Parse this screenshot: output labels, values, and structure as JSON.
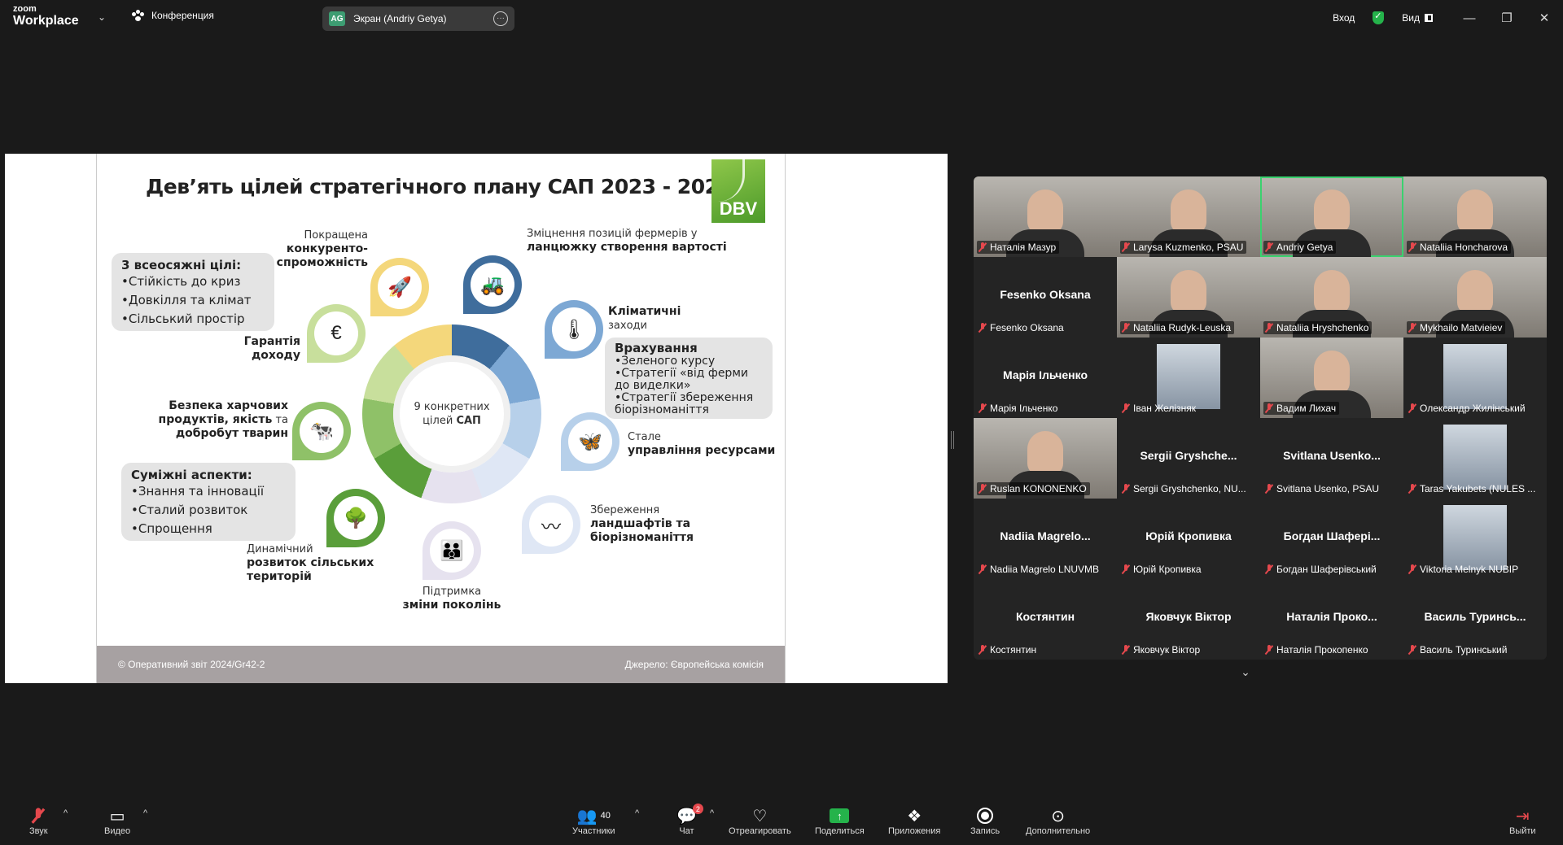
{
  "app": {
    "logo_top": "zoom",
    "logo_bottom": "Workplace",
    "meeting_label": "Конференция",
    "screen_badge": "AG",
    "screen_label": "Экран (Andriy Getya)",
    "signin_label": "Вход",
    "view_label": "Вид"
  },
  "slide": {
    "title": "Дев’ять цілей стратегічного плану САП 2023 - 2027",
    "logo": "DBV",
    "overarching": {
      "title": "3 всеосяжні цілі:",
      "items": [
        "•Стійкість до криз",
        "•Довкілля та клімат",
        "•Сільський простір"
      ]
    },
    "related": {
      "title": "Суміжні аспекти:",
      "items": [
        "•Знання та інновації",
        "•Сталий розвиток",
        "•Спрощення"
      ]
    },
    "considering": {
      "title": "Врахування",
      "items": [
        "•Зеленого курсу",
        "•Стратегії «від ферми до виделки»",
        "•Стратегії збереження біорізноманіття"
      ]
    },
    "center_line1": "9 конкретних",
    "center_line2a": "цілей ",
    "center_line2b": "САП",
    "goals": {
      "competitiveness_a": "Покращена",
      "competitiveness_b": "конкуренто-",
      "competitiveness_c": "спроможність",
      "farmers_a": "Зміцнення позицій фермерів у",
      "farmers_b": "ланцюжку створення вартості",
      "climate_a": "Кліматичні",
      "climate_b": "заходи",
      "income_a": "Гарантія",
      "income_b": "доходу",
      "food_a": "Безпека харчових",
      "food_b": "продуктів, якість",
      "food_b2": " та",
      "food_c": "добробут тварин",
      "resources_a": "Стале",
      "resources_b": "управління ресурсами",
      "landscape_a": "Збереження",
      "landscape_b": "ландшафтів та",
      "landscape_c": "біорізноманіття",
      "rural_a": "Динамічний",
      "rural_b": "розвиток сільських",
      "rural_c": "територій",
      "generations_a": "Підтримка",
      "generations_b": "зміни поколінь"
    },
    "footer_left": "© Оперативний звіт 2024/Gr42-2",
    "footer_right": "Джерело: Європейська комісія"
  },
  "participants": [
    {
      "label": "Наталія Мазур",
      "type": "video"
    },
    {
      "label": "Larysa Kuzmenko, PSAU",
      "type": "video"
    },
    {
      "label": "Andriy Getya",
      "type": "video",
      "active": true
    },
    {
      "label": "Nataliia Honcharova",
      "type": "video"
    },
    {
      "label": "Fesenko Oksana",
      "type": "name",
      "big": "Fesenko Oksana"
    },
    {
      "label": "Nataliia Rudyk-Leuska",
      "type": "video"
    },
    {
      "label": "Nataliia Hryshchenko",
      "type": "video"
    },
    {
      "label": "Mykhailo Matvieiev",
      "type": "video"
    },
    {
      "label": "Марія Ільченко",
      "type": "name",
      "big": "Марія Ільченко"
    },
    {
      "label": "Іван Желізняк",
      "type": "pic"
    },
    {
      "label": "Вадим Лихач",
      "type": "video"
    },
    {
      "label": "Олександр Жилінський",
      "type": "pic"
    },
    {
      "label": "Ruslan KONONENKO",
      "type": "video"
    },
    {
      "label": "Sergii Gryshchenko, NU...",
      "type": "name",
      "big": "Sergii  Gryshche..."
    },
    {
      "label": "Svitlana Usenko, PSAU",
      "type": "name",
      "big": "Svitlana  Usenko..."
    },
    {
      "label": "Taras Yakubets (NULES ...",
      "type": "pic"
    },
    {
      "label": "Nadiia Magrelo LNUVMB",
      "type": "name",
      "big": "Nadiia  Magrelo..."
    },
    {
      "label": "Юрій Кропивка",
      "type": "name",
      "big": "Юрій Кропивка"
    },
    {
      "label": "Богдан Шаферівський",
      "type": "name",
      "big": "Богдан  Шафері..."
    },
    {
      "label": "Viktoria Melnyk NUBIP",
      "type": "pic"
    },
    {
      "label": "Костянтин",
      "type": "name",
      "big": "Костянтин"
    },
    {
      "label": "Яковчук Віктор",
      "type": "name",
      "big": "Яковчук Віктор"
    },
    {
      "label": "Наталія Прокопенко",
      "type": "name",
      "big": "Наталія  Проко..."
    },
    {
      "label": "Василь Туринський",
      "type": "name",
      "big": "Василь  Туринсь..."
    }
  ],
  "toolbar": {
    "audio": "Звук",
    "video": "Видео",
    "participants": "Участники",
    "participants_count": "40",
    "chat": "Чат",
    "chat_badge": "2",
    "react": "Отреагировать",
    "share": "Поделиться",
    "apps": "Приложения",
    "record": "Запись",
    "more": "Дополнительно",
    "leave": "Выйти"
  },
  "colors": {
    "active_speaker": "#3bd16f",
    "share_green": "#25b34b",
    "mute_red": "#e5484d"
  }
}
